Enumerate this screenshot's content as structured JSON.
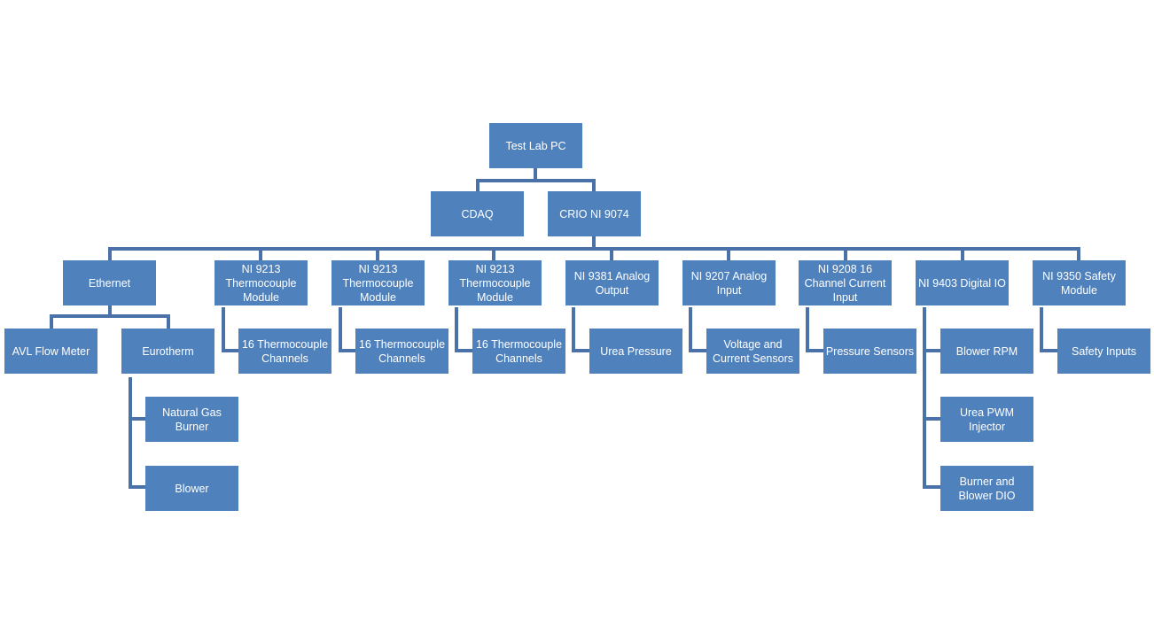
{
  "diagram": {
    "type": "org-chart",
    "colors": {
      "box_fill": "#4f81bd",
      "box_text": "#ffffff",
      "connector": "#4a72a8",
      "background": "#ffffff"
    },
    "nodes": {
      "root": {
        "label": "Test Lab PC"
      },
      "cdaq": {
        "label": "CDAQ"
      },
      "crio": {
        "label": "CRIO NI 9074"
      },
      "ethernet": {
        "label": "Ethernet"
      },
      "avl": {
        "label": "AVL Flow Meter"
      },
      "eurotherm": {
        "label": "Eurotherm"
      },
      "natural_gas_burner": {
        "label": "Natural Gas Burner"
      },
      "blower": {
        "label": "Blower"
      },
      "ni9213_1": {
        "label": "NI 9213 Thermocouple Module"
      },
      "tc_channels_1": {
        "label": "16 Thermocouple Channels"
      },
      "ni9213_2": {
        "label": "NI 9213 Thermocouple Module"
      },
      "tc_channels_2": {
        "label": "16 Thermocouple Channels"
      },
      "ni9213_3": {
        "label": "NI 9213 Thermocouple Module"
      },
      "tc_channels_3": {
        "label": "16 Thermocouple Channels"
      },
      "ni9381": {
        "label": "NI 9381  Analog Output"
      },
      "urea_pressure": {
        "label": "Urea Pressure"
      },
      "ni9207": {
        "label": "NI 9207  Analog Input"
      },
      "voltage_current_sensors": {
        "label": "Voltage and Current Sensors"
      },
      "ni9208": {
        "label": "NI 9208  16 Channel Current Input"
      },
      "pressure_sensors": {
        "label": "Pressure Sensors"
      },
      "ni9403": {
        "label": "NI 9403  Digital IO"
      },
      "blower_rpm": {
        "label": "Blower RPM"
      },
      "urea_pwm_injector": {
        "label": "Urea PWM Injector"
      },
      "burner_blower_dio": {
        "label": "Burner and Blower DIO"
      },
      "ni9350": {
        "label": "NI 9350  Safety Module"
      },
      "safety_inputs": {
        "label": "Safety Inputs"
      }
    },
    "edges": [
      [
        "root",
        "cdaq"
      ],
      [
        "root",
        "crio"
      ],
      [
        "crio",
        "ethernet"
      ],
      [
        "crio",
        "ni9213_1"
      ],
      [
        "crio",
        "ni9213_2"
      ],
      [
        "crio",
        "ni9213_3"
      ],
      [
        "crio",
        "ni9381"
      ],
      [
        "crio",
        "ni9207"
      ],
      [
        "crio",
        "ni9208"
      ],
      [
        "crio",
        "ni9403"
      ],
      [
        "crio",
        "ni9350"
      ],
      [
        "ethernet",
        "avl"
      ],
      [
        "ethernet",
        "eurotherm"
      ],
      [
        "eurotherm",
        "natural_gas_burner"
      ],
      [
        "eurotherm",
        "blower"
      ],
      [
        "ni9213_1",
        "tc_channels_1"
      ],
      [
        "ni9213_2",
        "tc_channels_2"
      ],
      [
        "ni9213_3",
        "tc_channels_3"
      ],
      [
        "ni9381",
        "urea_pressure"
      ],
      [
        "ni9207",
        "voltage_current_sensors"
      ],
      [
        "ni9208",
        "pressure_sensors"
      ],
      [
        "ni9403",
        "blower_rpm"
      ],
      [
        "ni9403",
        "urea_pwm_injector"
      ],
      [
        "ni9403",
        "burner_blower_dio"
      ],
      [
        "ni9350",
        "safety_inputs"
      ]
    ]
  }
}
